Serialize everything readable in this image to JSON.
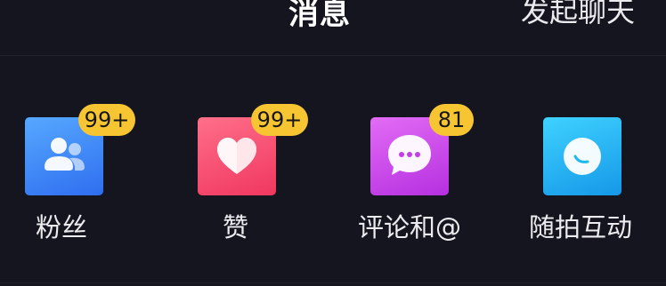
{
  "header": {
    "title": "消息",
    "start_chat": "发起聊天"
  },
  "entries": [
    {
      "label": "粉丝",
      "badge": "99+",
      "icon": "fans-icon",
      "color": "#3b82f6"
    },
    {
      "label": "赞",
      "badge": "99+",
      "icon": "heart-icon",
      "color": "#f5466d"
    },
    {
      "label": "评论和@",
      "badge": "81",
      "icon": "comment-icon",
      "color": "#c23ee8"
    },
    {
      "label": "随拍互动",
      "badge": "",
      "icon": "snapshot-icon",
      "color": "#1eb8ee"
    }
  ],
  "colors": {
    "background": "#15151f",
    "badge": "#f7c531"
  }
}
